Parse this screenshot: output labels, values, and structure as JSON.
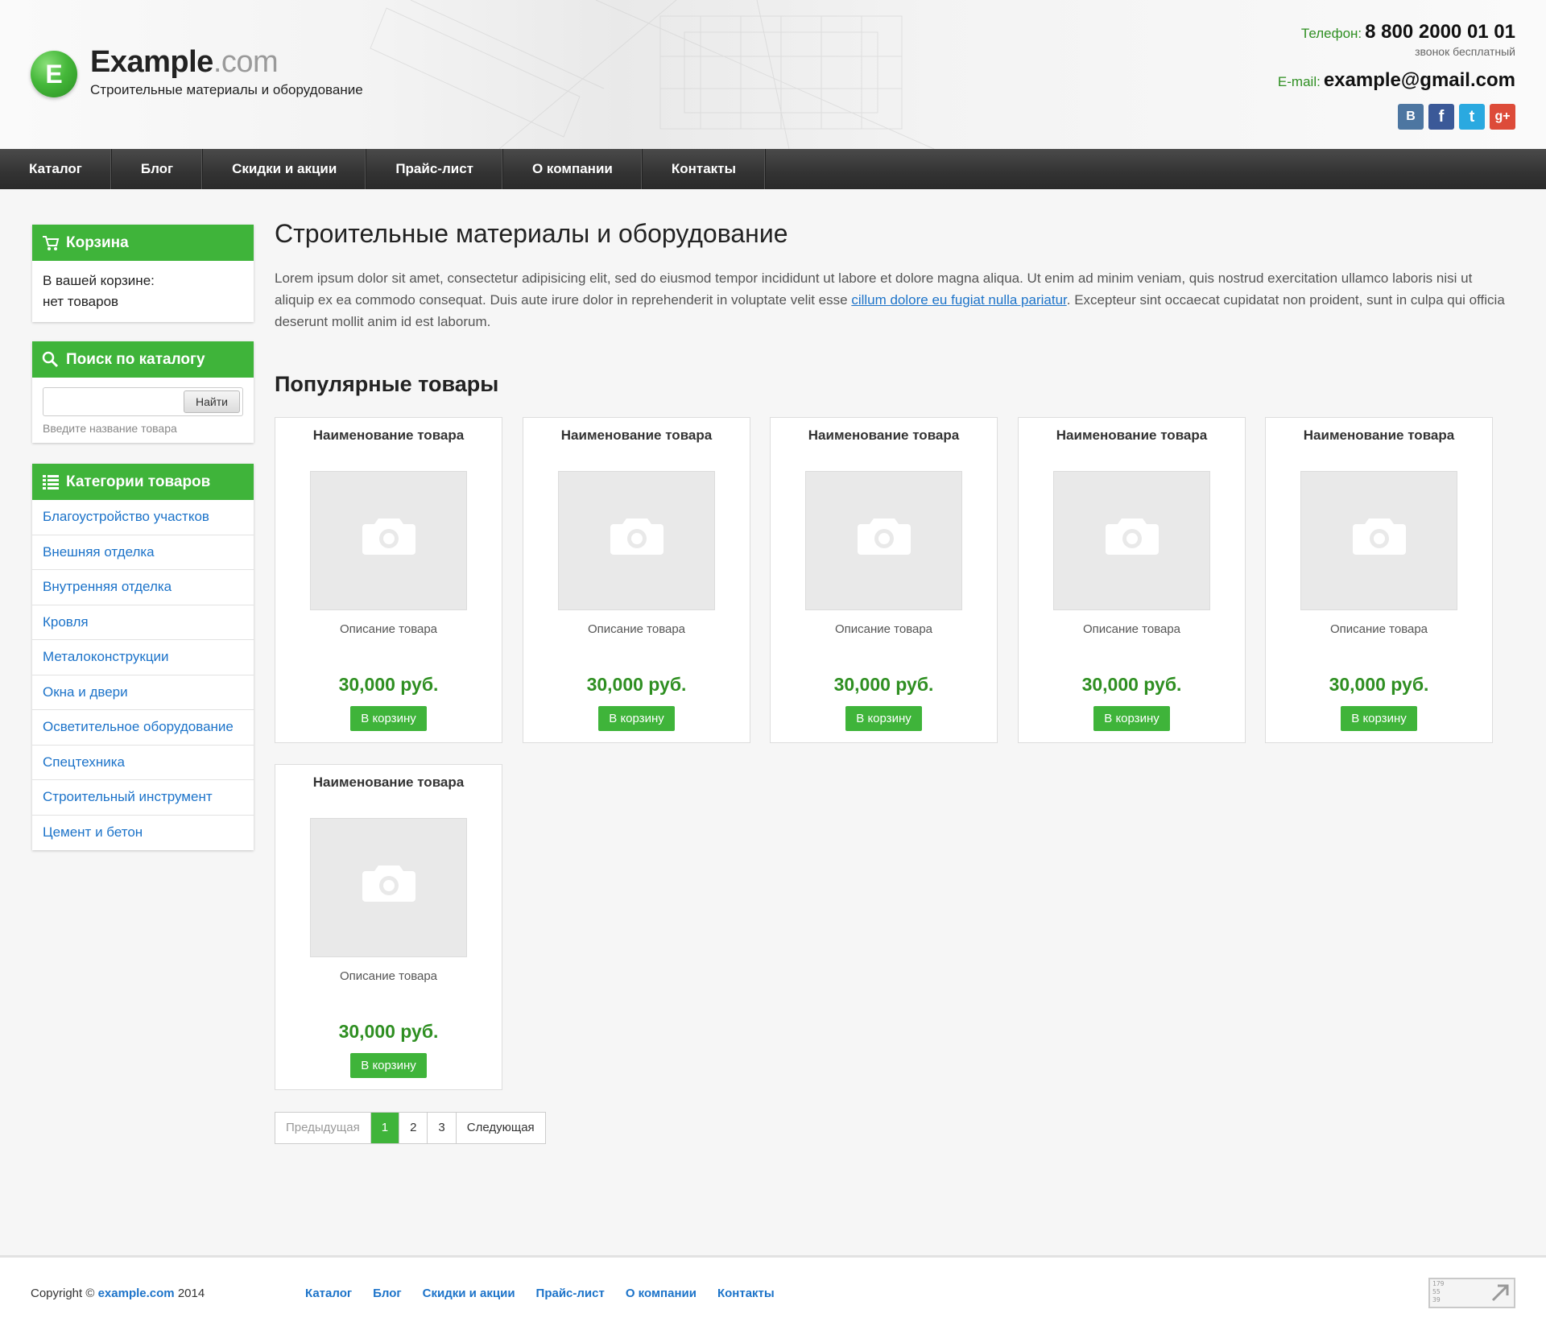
{
  "header": {
    "logo_letter": "E",
    "logo_name": "Example",
    "logo_tld": ".com",
    "slogan": "Строительные материалы и оборудование",
    "phone_label": "Телефон:",
    "phone_value": "8 800 2000 01 01",
    "phone_note": "звонок бесплатный",
    "email_label": "E-mail:",
    "email_value": "example@gmail.com",
    "socials": [
      {
        "name": "vk-icon",
        "glyph": "B"
      },
      {
        "name": "facebook-icon",
        "glyph": "f"
      },
      {
        "name": "twitter-icon",
        "glyph": "t"
      },
      {
        "name": "google-plus-icon",
        "glyph": "g+"
      }
    ]
  },
  "nav": {
    "items": [
      "Каталог",
      "Блог",
      "Скидки и акции",
      "Прайс-лист",
      "О компании",
      "Контакты"
    ]
  },
  "sidebar": {
    "cart": {
      "title": "Корзина",
      "line1": "В вашей корзине:",
      "line2": "нет товаров"
    },
    "search": {
      "title": "Поиск по каталогу",
      "input_value": "",
      "button": "Найти",
      "hint": "Введите название товара"
    },
    "categories": {
      "title": "Категории товаров",
      "items": [
        "Благоустройство участков",
        "Внешняя отделка",
        "Внутренняя отделка",
        "Кровля",
        "Металоконструкции",
        "Окна и двери",
        "Осветительное оборудование",
        "Спецтехника",
        "Строительный инструмент",
        "Цемент и бетон"
      ]
    }
  },
  "main": {
    "title": "Строительные материалы и оборудование",
    "intro_before": "Lorem ipsum dolor sit amet, consectetur adipisicing elit, sed do eiusmod tempor incididunt ut labore et dolore magna aliqua. Ut enim ad minim veniam, quis nostrud exercitation ullamco laboris nisi ut aliquip ex ea commodo consequat. Duis aute irure dolor in reprehenderit in voluptate velit esse ",
    "intro_link": "cillum dolore eu fugiat nulla pariatur",
    "intro_after": ". Excepteur sint occaecat cupidatat non proident, sunt in culpa qui officia deserunt mollit anim id est laborum.",
    "popular_title": "Популярные товары",
    "products": [
      {
        "name": "Наименование товара",
        "desc": "Описание товара",
        "price": "30,000 руб.",
        "button": "В корзину"
      },
      {
        "name": "Наименование товара",
        "desc": "Описание товара",
        "price": "30,000 руб.",
        "button": "В корзину"
      },
      {
        "name": "Наименование товара",
        "desc": "Описание товара",
        "price": "30,000 руб.",
        "button": "В корзину"
      },
      {
        "name": "Наименование товара",
        "desc": "Описание товара",
        "price": "30,000 руб.",
        "button": "В корзину"
      },
      {
        "name": "Наименование товара",
        "desc": "Описание товара",
        "price": "30,000 руб.",
        "button": "В корзину"
      },
      {
        "name": "Наименование товара",
        "desc": "Описание товара",
        "price": "30,000 руб.",
        "button": "В корзину"
      }
    ],
    "pager": {
      "prev": "Предыдущая",
      "pages": [
        "1",
        "2",
        "3"
      ],
      "active": "1",
      "next": "Следующая"
    }
  },
  "footer": {
    "copyright_prefix": "Copyright ©",
    "copyright_brand": "example.com",
    "copyright_year": "2014",
    "links": [
      "Каталог",
      "Блог",
      "Скидки и акции",
      "Прайс-лист",
      "О компании",
      "Контакты"
    ],
    "counter_numbers": [
      "179",
      "55",
      "39"
    ]
  },
  "colors": {
    "accent": "#3fb43a",
    "price": "#2f8f22",
    "link": "#1c73c9",
    "nav": "#333333"
  }
}
